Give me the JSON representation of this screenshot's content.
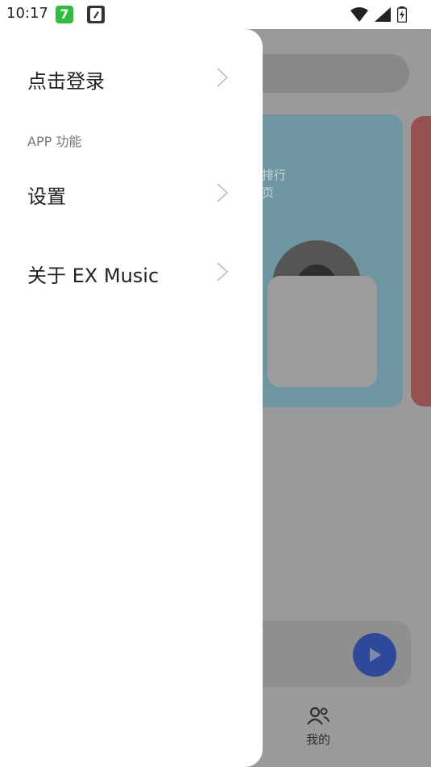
{
  "status_bar": {
    "time": "10:17",
    "icons": [
      "app-7-icon",
      "edit-app-icon",
      "wifi-icon",
      "signal-icon",
      "battery-icon"
    ]
  },
  "drawer": {
    "login_label": "点击登录",
    "section_title": "APP 功能",
    "settings_label": "设置",
    "about_label": "关于 EX Music"
  },
  "background": {
    "card_text": "排行\n页",
    "nav_me_label": "我的"
  },
  "colors": {
    "drawer_bg": "#ffffff",
    "overlay_bg": "#9a9a9a",
    "play_button": "#2d4a9a",
    "card_teal": "#6e96a0",
    "card_red": "#955150"
  }
}
